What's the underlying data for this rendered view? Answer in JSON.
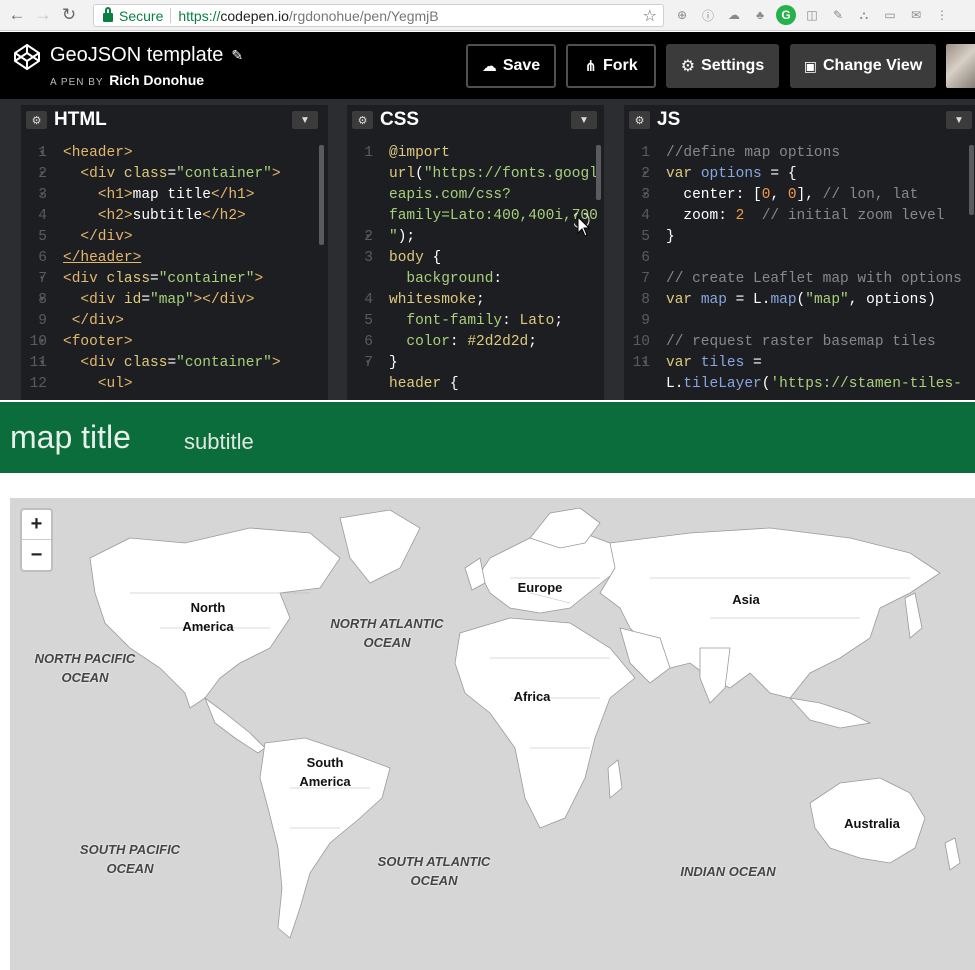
{
  "browser": {
    "secure_label": "Secure",
    "url_scheme": "https://",
    "url_host": "codepen.io",
    "url_path": "/rgdonohue/pen/YegmjB"
  },
  "header": {
    "pen_title": "GeoJSON template",
    "pen_by": "A PEN BY",
    "author": "Rich Donohue",
    "save_label": "Save",
    "fork_label": "Fork",
    "settings_label": "Settings",
    "change_view_label": "Change View"
  },
  "editors": {
    "html": {
      "title": "HTML"
    },
    "css": {
      "title": "CSS"
    },
    "js": {
      "title": "JS"
    }
  },
  "output": {
    "title": "map title",
    "subtitle": "subtitle",
    "zoom_in": "+",
    "zoom_out": "−",
    "labels": {
      "north_america": "North America",
      "south_america": "South America",
      "europe": "Europe",
      "africa": "Africa",
      "asia": "Asia",
      "australia": "Australia",
      "north_atlantic": "NORTH ATLANTIC OCEAN",
      "north_pacific": "NORTH PACIFIC OCEAN",
      "south_pacific": "SOUTH PACIFIC OCEAN",
      "south_atlantic": "SOUTH ATLANTIC OCEAN",
      "indian": "INDIAN OCEAN"
    }
  },
  "colors": {
    "codepen_header": "#000000",
    "editor_bg": "#1d1e22",
    "output_banner": "#0b6d3c",
    "map_water": "#d6d6d6",
    "map_land": "#ffffff"
  }
}
